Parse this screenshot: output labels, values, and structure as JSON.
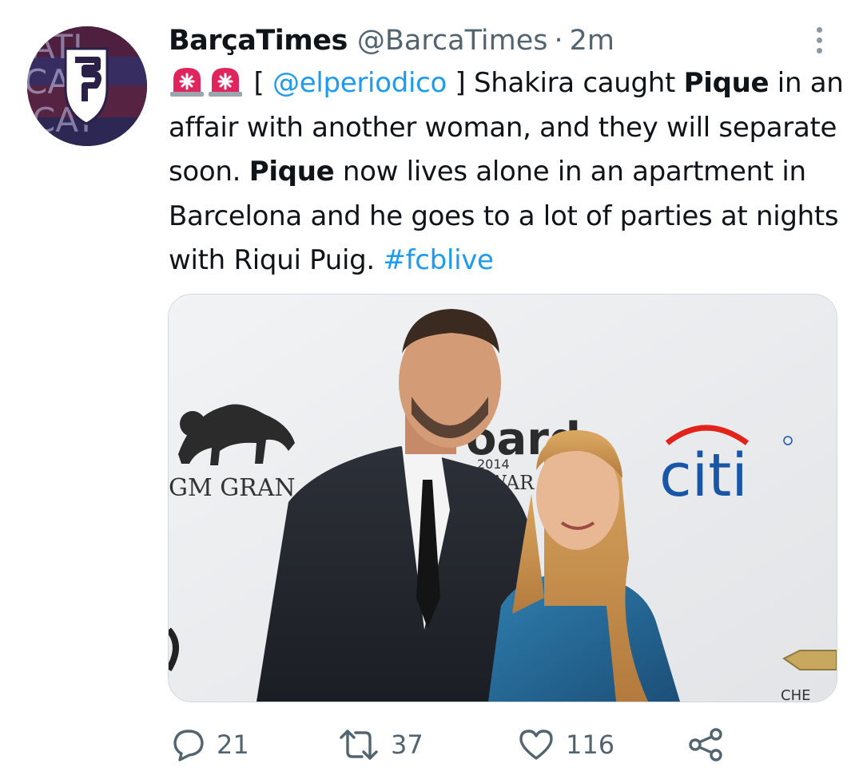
{
  "tweet": {
    "author": {
      "display_name": "BarçaTimes",
      "handle": "@BarcaTimes"
    },
    "separator": "·",
    "time": "2m",
    "text": {
      "siren_emoji": [
        "police-car-light",
        "police-car-light"
      ],
      "bracket_open": "[",
      "mention": "@elperiodico",
      "bracket_close": "]",
      "segment_1": "Shakira caught",
      "bold_1": "Pique",
      "segment_2": "in an affair with another woman, and they will separate soon.",
      "bold_2": "Pique",
      "segment_3": "now lives alone in an apartment in Barcelona and he goes to a lot of parties at nights with Riqui Puig.",
      "hashtag": "#fcblive"
    },
    "media": {
      "backdrop_logos": {
        "mgm": "GM GRAN",
        "billboard": "oard",
        "billboard_year": "2014",
        "billboard_awards": "AWAR",
        "citi": "citi",
        "chevrolet": "CHE"
      }
    },
    "actions": {
      "reply_count": "21",
      "retweet_count": "37",
      "like_count": "116"
    }
  },
  "colors": {
    "text": "#0f1419",
    "secondary": "#536471",
    "link": "#1d9bf0",
    "siren": "#e0245e"
  },
  "icons": {
    "more": "more-vertical-icon",
    "reply": "reply-bubble-icon",
    "retweet": "retweet-arrows-icon",
    "like": "heart-icon",
    "share": "share-nodes-icon"
  }
}
